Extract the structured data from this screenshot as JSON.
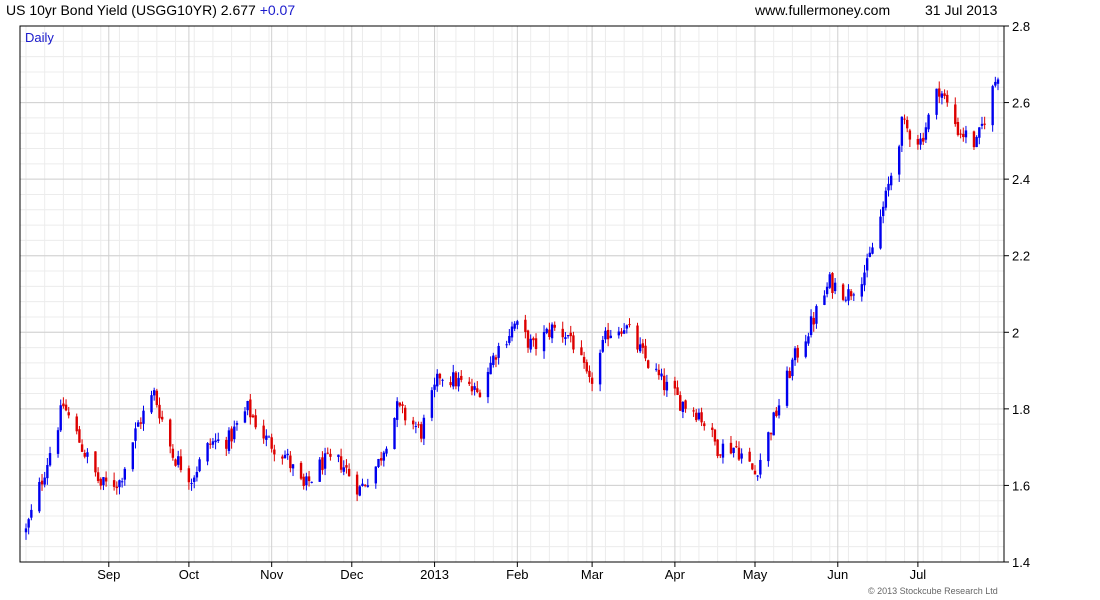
{
  "header": {
    "title": "US 10yr Bond Yield (USGG10YR)",
    "last_value": "2.677",
    "change": "+0.07",
    "site": "www.fullermoney.com",
    "date": "31 Jul 2013"
  },
  "copyright": "© 2013 Stockcube Research Ltd",
  "colors": {
    "up": "#0000ee",
    "down": "#dd0000",
    "grid": "#d0d0d0",
    "minor_grid": "#ececec",
    "axis": "#000000",
    "period_label": "#1a1acc"
  },
  "chart_data": {
    "type": "candlestick",
    "period_label": "Daily",
    "title": "US 10yr Bond Yield (USGG10YR)",
    "xlabel": "",
    "ylabel": "",
    "ylim": [
      1.4,
      2.8
    ],
    "y_ticks": [
      "1.4",
      "1.6",
      "1.8",
      "2",
      "2.2",
      "2.4",
      "2.6",
      "2.8"
    ],
    "y_axis_position": "right",
    "grid": true,
    "x_tick_labels": [
      "Sep",
      "Oct",
      "Nov",
      "Dec",
      "2013",
      "Feb",
      "Mar",
      "Apr",
      "May",
      "Jun",
      "Jul"
    ],
    "x_tick_dates": [
      "2012-09-01",
      "2012-10-01",
      "2012-11-01",
      "2012-12-01",
      "2013-01-01",
      "2013-02-01",
      "2013-03-01",
      "2013-04-01",
      "2013-05-01",
      "2013-06-01",
      "2013-07-01"
    ],
    "x_range": [
      "2012-08-01",
      "2013-07-31"
    ],
    "closes": [
      {
        "date": "2012-08-01",
        "close": 1.48
      },
      {
        "date": "2012-08-08",
        "close": 1.64
      },
      {
        "date": "2012-08-15",
        "close": 1.81
      },
      {
        "date": "2012-08-22",
        "close": 1.7
      },
      {
        "date": "2012-08-29",
        "close": 1.6
      },
      {
        "date": "2012-09-05",
        "close": 1.61
      },
      {
        "date": "2012-09-12",
        "close": 1.76
      },
      {
        "date": "2012-09-18",
        "close": 1.84
      },
      {
        "date": "2012-09-25",
        "close": 1.68
      },
      {
        "date": "2012-10-02",
        "close": 1.62
      },
      {
        "date": "2012-10-09",
        "close": 1.71
      },
      {
        "date": "2012-10-16",
        "close": 1.72
      },
      {
        "date": "2012-10-23",
        "close": 1.8
      },
      {
        "date": "2012-10-30",
        "close": 1.72
      },
      {
        "date": "2012-11-06",
        "close": 1.68
      },
      {
        "date": "2012-11-13",
        "close": 1.59
      },
      {
        "date": "2012-11-20",
        "close": 1.66
      },
      {
        "date": "2012-11-27",
        "close": 1.66
      },
      {
        "date": "2012-12-04",
        "close": 1.59
      },
      {
        "date": "2012-12-11",
        "close": 1.66
      },
      {
        "date": "2012-12-18",
        "close": 1.8
      },
      {
        "date": "2012-12-27",
        "close": 1.74
      },
      {
        "date": "2013-01-03",
        "close": 1.89
      },
      {
        "date": "2013-01-10",
        "close": 1.87
      },
      {
        "date": "2013-01-17",
        "close": 1.84
      },
      {
        "date": "2013-01-24",
        "close": 1.95
      },
      {
        "date": "2013-01-31",
        "close": 2.02
      },
      {
        "date": "2013-02-07",
        "close": 1.96
      },
      {
        "date": "2013-02-14",
        "close": 2.01
      },
      {
        "date": "2013-02-21",
        "close": 1.99
      },
      {
        "date": "2013-02-28",
        "close": 1.86
      },
      {
        "date": "2013-03-07",
        "close": 2.0
      },
      {
        "date": "2013-03-13",
        "close": 2.02
      },
      {
        "date": "2013-03-20",
        "close": 1.94
      },
      {
        "date": "2013-03-27",
        "close": 1.87
      },
      {
        "date": "2013-04-03",
        "close": 1.82
      },
      {
        "date": "2013-04-10",
        "close": 1.79
      },
      {
        "date": "2013-04-17",
        "close": 1.7
      },
      {
        "date": "2013-04-24",
        "close": 1.7
      },
      {
        "date": "2013-05-01",
        "close": 1.63
      },
      {
        "date": "2013-05-08",
        "close": 1.77
      },
      {
        "date": "2013-05-15",
        "close": 1.92
      },
      {
        "date": "2013-05-22",
        "close": 2.02
      },
      {
        "date": "2013-05-29",
        "close": 2.13
      },
      {
        "date": "2013-06-05",
        "close": 2.1
      },
      {
        "date": "2013-06-12",
        "close": 2.17
      },
      {
        "date": "2013-06-19",
        "close": 2.35
      },
      {
        "date": "2013-06-25",
        "close": 2.54
      },
      {
        "date": "2013-07-02",
        "close": 2.5
      },
      {
        "date": "2013-07-09",
        "close": 2.64
      },
      {
        "date": "2013-07-16",
        "close": 2.53
      },
      {
        "date": "2013-07-23",
        "close": 2.49
      },
      {
        "date": "2013-07-31",
        "close": 2.68
      }
    ]
  }
}
